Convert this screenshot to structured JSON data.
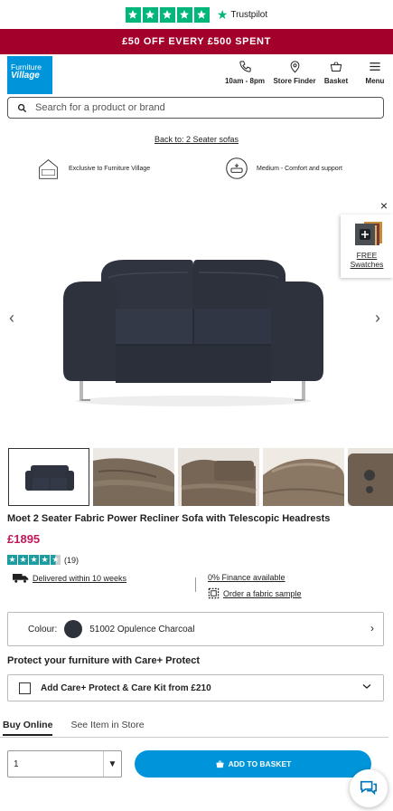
{
  "trustpilot": {
    "label": "Trustpilot",
    "star_color": "#00b67a",
    "stars": 5
  },
  "promo": {
    "text": "£50 OFF EVERY £500 SPENT",
    "bg": "#a3002c"
  },
  "header": {
    "logo_line1": "Furniture",
    "logo_line2": "Village",
    "logo_color": "#0095da",
    "hours_label": "10am - 8pm",
    "store_finder_label": "Store Finder",
    "basket_label": "Basket",
    "menu_label": "Menu"
  },
  "search": {
    "placeholder": "Search for a product or brand",
    "value": ""
  },
  "breadcrumb": {
    "back_link": "Back to: 2 Seater sofas"
  },
  "features": {
    "exclusive": "Exclusive to Furniture Village",
    "comfort": "Medium - Comfort and support",
    "exclusive_icon_text": "Furniture Village"
  },
  "gallery": {
    "swatch_label_line1": "FREE",
    "swatch_label_line2": "Swatches",
    "close_icon": "×",
    "prev_icon": "‹",
    "next_icon": "›",
    "thumb_count_visible": 5
  },
  "product": {
    "title": "Moet 2 Seater Fabric Power Recliner Sofa with Telescopic Headrests",
    "price": "£1895",
    "price_color": "#c2185b",
    "rating": 4.5,
    "review_count": "(19)",
    "star_color": "#1a9ca0"
  },
  "info": {
    "delivery": "Delivered within 10 weeks",
    "finance": "0% Finance available",
    "sample": "Order a fabric sample"
  },
  "colour": {
    "label": "Colour:",
    "value": "51002 Opulence Charcoal",
    "swatch_color": "#2e323a"
  },
  "protect": {
    "heading": "Protect your furniture with Care+ Protect",
    "option_label": "Add Care+ Protect & Care Kit from £210"
  },
  "tabs": [
    {
      "label": "Buy Online",
      "active": true
    },
    {
      "label": "See Item in Store",
      "active": false
    }
  ],
  "buy": {
    "quantity": "1",
    "add_to_basket": "ADD TO BASKET",
    "button_color": "#0095da"
  }
}
